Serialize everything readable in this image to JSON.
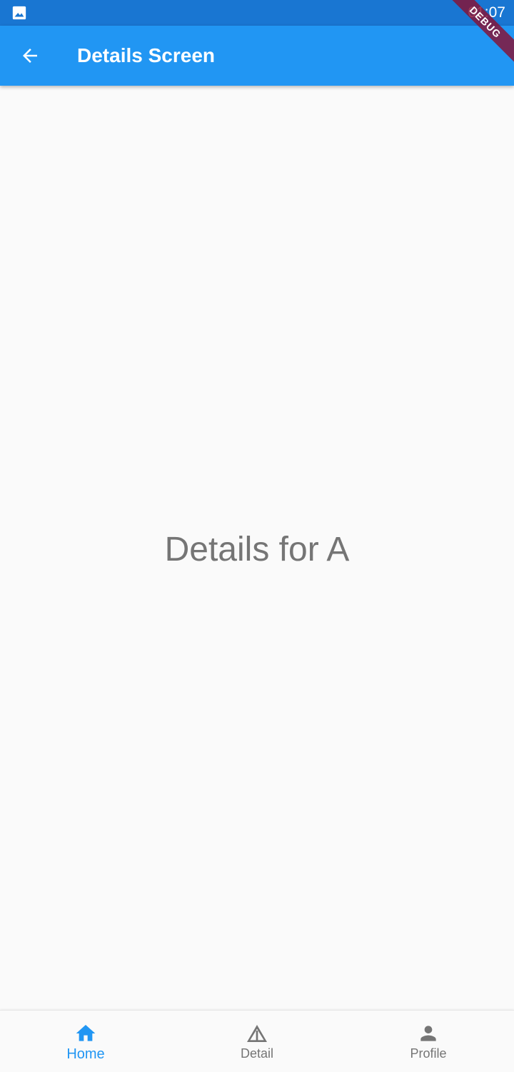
{
  "status_bar": {
    "time": "01:07",
    "left_icon": "image-icon"
  },
  "debug_banner": {
    "label": "DEBUG"
  },
  "app_bar": {
    "title": "Details Screen",
    "back_icon": "arrow-back-icon"
  },
  "content": {
    "text": "Details for A"
  },
  "bottom_nav": {
    "selected_index": 0,
    "items": [
      {
        "label": "Home",
        "icon": "home-icon"
      },
      {
        "label": "Detail",
        "icon": "warning-triangle-icon"
      },
      {
        "label": "Profile",
        "icon": "person-icon"
      }
    ]
  },
  "colors": {
    "primary": "#2196f3",
    "status_bar": "#1976d2",
    "background": "#fafafa",
    "text_secondary": "#757575",
    "debug_ribbon": "#881133"
  }
}
